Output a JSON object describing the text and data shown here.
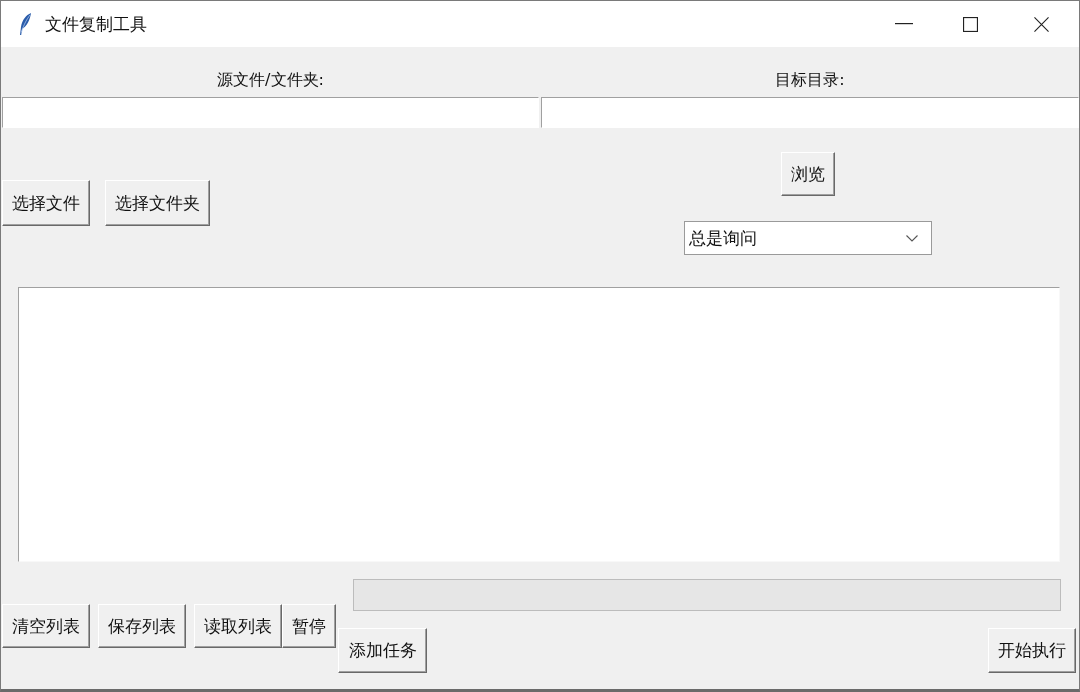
{
  "window": {
    "title": "文件复制工具"
  },
  "source": {
    "label": "源文件/文件夹:",
    "buttons": [
      "选择文件",
      "选择文件夹"
    ]
  },
  "target": {
    "label": "目标目录:",
    "browse_button": "浏览",
    "mode": "总是询问"
  },
  "progress": {
    "level": 0
  },
  "list_buttons": [
    "清空列表",
    "保存列表",
    "读取列表"
  ],
  "pause_button": "暂停",
  "add_task_button": "添加任务",
  "start_button": "开始执行"
}
